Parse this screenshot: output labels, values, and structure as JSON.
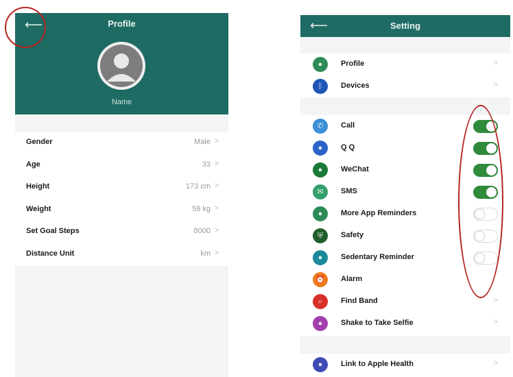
{
  "profile": {
    "title": "Profile",
    "name": "Name",
    "rows": [
      {
        "label": "Gender",
        "value": "Male"
      },
      {
        "label": "Age",
        "value": "33"
      },
      {
        "label": "Height",
        "value": "173 cm"
      },
      {
        "label": "Weight",
        "value": "59 kg"
      },
      {
        "label": "Set Goal Steps",
        "value": "8000"
      },
      {
        "label": "Distance Unit",
        "value": "km"
      }
    ]
  },
  "setting": {
    "title": "Setting",
    "group1": [
      {
        "label": "Profile",
        "icon": "person-icon",
        "color": "#2e8b57"
      },
      {
        "label": "Devices",
        "icon": "bluetooth-icon",
        "color": "#1f55b8"
      }
    ],
    "group2": [
      {
        "label": "Call",
        "icon": "phone-icon",
        "color": "#3a8fd6",
        "toggle": true
      },
      {
        "label": "Q Q",
        "icon": "qq-icon",
        "color": "#2a63c9",
        "toggle": true
      },
      {
        "label": "WeChat",
        "icon": "wechat-icon",
        "color": "#1b7a37",
        "toggle": true
      },
      {
        "label": "SMS",
        "icon": "message-icon",
        "color": "#34a06b",
        "toggle": true
      },
      {
        "label": "More App Reminders",
        "icon": "app-icon",
        "color": "#2e8b57",
        "toggle": false
      },
      {
        "label": "Safety",
        "icon": "shield-icon",
        "color": "#1f5e2c",
        "toggle": false
      },
      {
        "label": "Sedentary Reminder",
        "icon": "sedentary-icon",
        "color": "#1a8a9a",
        "toggle": false
      },
      {
        "label": "Alarm",
        "icon": "alarm-icon",
        "color": "#f07a1a"
      },
      {
        "label": "Find Band",
        "icon": "search-icon",
        "color": "#d8302a"
      },
      {
        "label": "Shake to Take Selfie",
        "icon": "camera-icon",
        "color": "#a23fae"
      }
    ],
    "group3": [
      {
        "label": "Link to Apple Health",
        "icon": "health-icon",
        "color": "#3f4bb5"
      }
    ]
  },
  "colors": {
    "header": "#1e6b64",
    "toggle_on": "#2f8a3a",
    "annotation": "#b3231f"
  }
}
